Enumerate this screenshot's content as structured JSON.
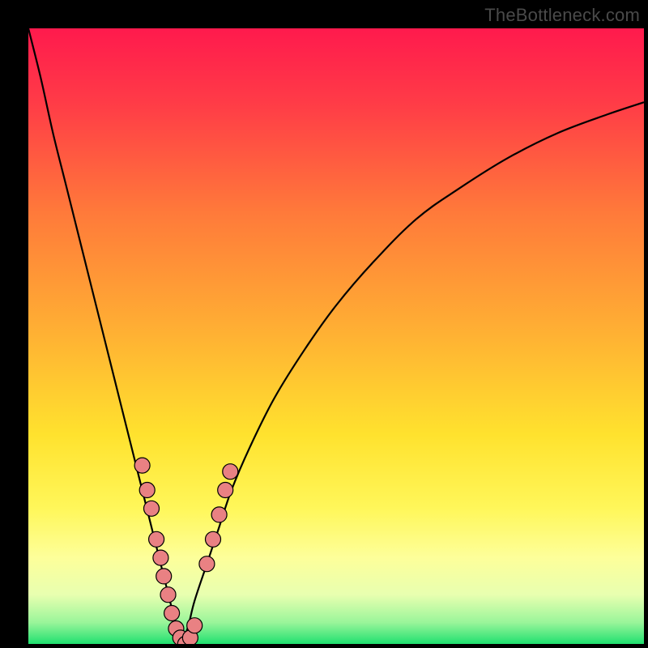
{
  "watermark": "TheBottleneck.com",
  "colors": {
    "frame": "#000000",
    "gradient_stops": [
      {
        "offset": 0.0,
        "color": "#ff1a4d"
      },
      {
        "offset": 0.12,
        "color": "#ff3b47"
      },
      {
        "offset": 0.3,
        "color": "#ff7a3a"
      },
      {
        "offset": 0.5,
        "color": "#ffb233"
      },
      {
        "offset": 0.66,
        "color": "#ffe22e"
      },
      {
        "offset": 0.78,
        "color": "#fff75a"
      },
      {
        "offset": 0.86,
        "color": "#fdff9a"
      },
      {
        "offset": 0.92,
        "color": "#e8ffb0"
      },
      {
        "offset": 0.965,
        "color": "#9af59a"
      },
      {
        "offset": 1.0,
        "color": "#20e070"
      }
    ],
    "curve": "#000000",
    "marker_fill": "#e98183",
    "marker_stroke": "#000000"
  },
  "chart_data": {
    "type": "line",
    "title": "",
    "xlabel": "",
    "ylabel": "",
    "xlim": [
      0,
      100
    ],
    "ylim": [
      0,
      100
    ],
    "series": [
      {
        "name": "left-curve",
        "x": [
          0,
          2,
          4,
          6,
          8,
          10,
          12,
          14,
          16,
          18,
          20,
          22,
          23,
          24,
          25
        ],
        "y": [
          100,
          92,
          83,
          75,
          67,
          59,
          51,
          43,
          35,
          27,
          19,
          11,
          7,
          3,
          0
        ]
      },
      {
        "name": "right-curve",
        "x": [
          25,
          26,
          27,
          29,
          31,
          33,
          36,
          40,
          45,
          50,
          56,
          63,
          70,
          78,
          86,
          94,
          100
        ],
        "y": [
          0,
          3,
          7,
          13,
          19,
          25,
          32,
          40,
          48,
          55,
          62,
          69,
          74,
          79,
          83,
          86,
          88
        ]
      }
    ],
    "markers": [
      {
        "x": 18.5,
        "y": 29
      },
      {
        "x": 19.3,
        "y": 25
      },
      {
        "x": 20.0,
        "y": 22
      },
      {
        "x": 20.8,
        "y": 17
      },
      {
        "x": 21.5,
        "y": 14
      },
      {
        "x": 22.0,
        "y": 11
      },
      {
        "x": 22.7,
        "y": 8
      },
      {
        "x": 23.3,
        "y": 5
      },
      {
        "x": 24.0,
        "y": 2.5
      },
      {
        "x": 24.7,
        "y": 1
      },
      {
        "x": 25.5,
        "y": 0
      },
      {
        "x": 26.3,
        "y": 1
      },
      {
        "x": 27.0,
        "y": 3
      },
      {
        "x": 29.0,
        "y": 13
      },
      {
        "x": 30.0,
        "y": 17
      },
      {
        "x": 31.0,
        "y": 21
      },
      {
        "x": 32.0,
        "y": 25
      },
      {
        "x": 32.8,
        "y": 28
      }
    ],
    "marker_radius_data_units": 1.25
  }
}
